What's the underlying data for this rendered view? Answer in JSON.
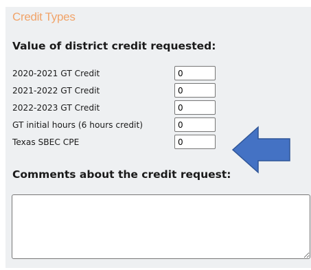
{
  "section": {
    "title": "Credit Types",
    "value_heading": "Value of district credit requested:",
    "comments_heading": "Comments about the credit request:"
  },
  "credits": [
    {
      "label": "2020-2021 GT Credit",
      "value": "0"
    },
    {
      "label": "2021-2022 GT Credit",
      "value": "0"
    },
    {
      "label": "2022-2023 GT Credit",
      "value": "0"
    },
    {
      "label": "GT initial hours (6 hours credit)",
      "value": "0"
    },
    {
      "label": "Texas SBEC CPE",
      "value": "0"
    }
  ],
  "comments": {
    "value": ""
  },
  "annotation": {
    "icon": "left-arrow-icon",
    "color": "#4472c4",
    "stroke": "#2f5597"
  },
  "colors": {
    "section_title": "#f1a46a",
    "panel_background": "#eef0f2"
  }
}
